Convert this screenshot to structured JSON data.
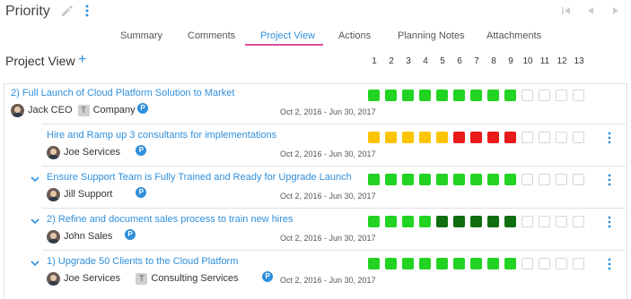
{
  "header": {
    "title": "Priority",
    "icons": [
      "pencil-icon",
      "more-vertical-icon",
      "first-page-icon",
      "previous-icon",
      "next-icon"
    ]
  },
  "tabs": [
    {
      "label": "Summary",
      "active": false
    },
    {
      "label": "Comments",
      "active": false
    },
    {
      "label": "Project View",
      "active": true
    },
    {
      "label": "Actions",
      "active": false
    },
    {
      "label": "Planning Notes",
      "active": false
    },
    {
      "label": "Attachments",
      "active": false
    }
  ],
  "project_view": {
    "title": "Project View",
    "add_label": "+",
    "columns": [
      "1",
      "2",
      "3",
      "4",
      "5",
      "6",
      "7",
      "8",
      "9",
      "10",
      "11",
      "12",
      "13"
    ]
  },
  "colors": {
    "accent": "#2f8fdb",
    "tab_underline": "#d94f9c",
    "green": "#22d322",
    "dark_green": "#0f6e0f",
    "yellow": "#fbc400",
    "red": "#e81a1a",
    "empty": "#ffffff"
  },
  "rows": [
    {
      "title": "2) Full Launch of Cloud Platform Solution to Market",
      "owner": "Jack CEO",
      "team_badge": "T",
      "team": "Company",
      "p_badge": "P",
      "dates": "Oct 2, 2016 - Jun 30, 2017",
      "status": [
        "green",
        "green",
        "green",
        "green",
        "green",
        "green",
        "green",
        "green",
        "green",
        "empty",
        "empty",
        "empty",
        "empty"
      ]
    },
    {
      "title": "Hire and Ramp up 3 consultants for implementations",
      "owner": "Joe Services",
      "p_badge": "P",
      "dates": "Oct 2, 2016 - Jun 30, 2017",
      "status": [
        "yellow",
        "yellow",
        "yellow",
        "yellow",
        "yellow",
        "red",
        "red",
        "red",
        "red",
        "empty",
        "empty",
        "empty",
        "empty"
      ]
    },
    {
      "title": "Ensure Support Team is Fully Trained and Ready for Upgrade Launch",
      "owner": "Jill Support",
      "p_badge": "P",
      "dates": "Oct 2, 2016 - Jun 30, 2017",
      "status": [
        "green",
        "green",
        "green",
        "green",
        "green",
        "green",
        "green",
        "green",
        "green",
        "empty",
        "empty",
        "empty",
        "empty"
      ]
    },
    {
      "title": "2) Refine and document sales process to train new hires",
      "owner": "John Sales",
      "p_badge": "P",
      "dates": "Oct 2, 2016 - Jun 30, 2017",
      "status": [
        "green",
        "green",
        "green",
        "green",
        "dark_green",
        "dark_green",
        "dark_green",
        "dark_green",
        "dark_green",
        "empty",
        "empty",
        "empty",
        "empty"
      ]
    },
    {
      "title": "1) Upgrade 50 Clients to the Cloud Platform",
      "owner": "Joe Services",
      "team_badge": "T",
      "team": "Consulting Services",
      "p_badge": "P",
      "dates": "Oct 2, 2016 - Jun 30, 2017",
      "status": [
        "green",
        "green",
        "green",
        "green",
        "green",
        "green",
        "green",
        "green",
        "green",
        "empty",
        "empty",
        "empty",
        "empty"
      ]
    }
  ]
}
